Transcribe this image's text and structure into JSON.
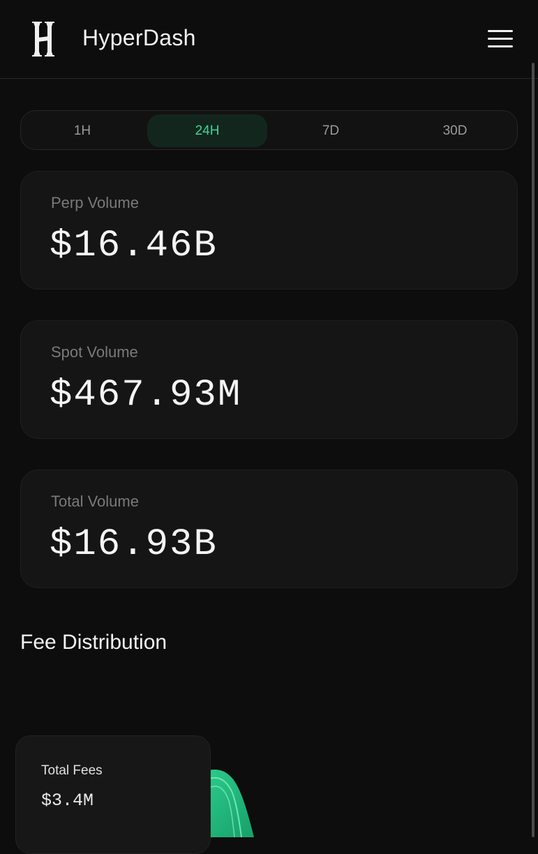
{
  "header": {
    "app_title": "HyperDash",
    "logo_icon": "hyperdash-logo-icon",
    "menu_icon": "hamburger-menu-icon"
  },
  "time_range": {
    "options": [
      "1H",
      "24H",
      "7D",
      "30D"
    ],
    "selected": "24H",
    "accent_color": "#3fd496"
  },
  "stats": [
    {
      "label": "Perp Volume",
      "value": "$16.46B"
    },
    {
      "label": "Spot Volume",
      "value": "$467.93M"
    },
    {
      "label": "Total Volume",
      "value": "$16.93B"
    }
  ],
  "fee_distribution": {
    "title": "Fee Distribution",
    "total_label": "Total Fees",
    "total_value": "$3.4M",
    "chart_color": "#2ecf8e"
  }
}
